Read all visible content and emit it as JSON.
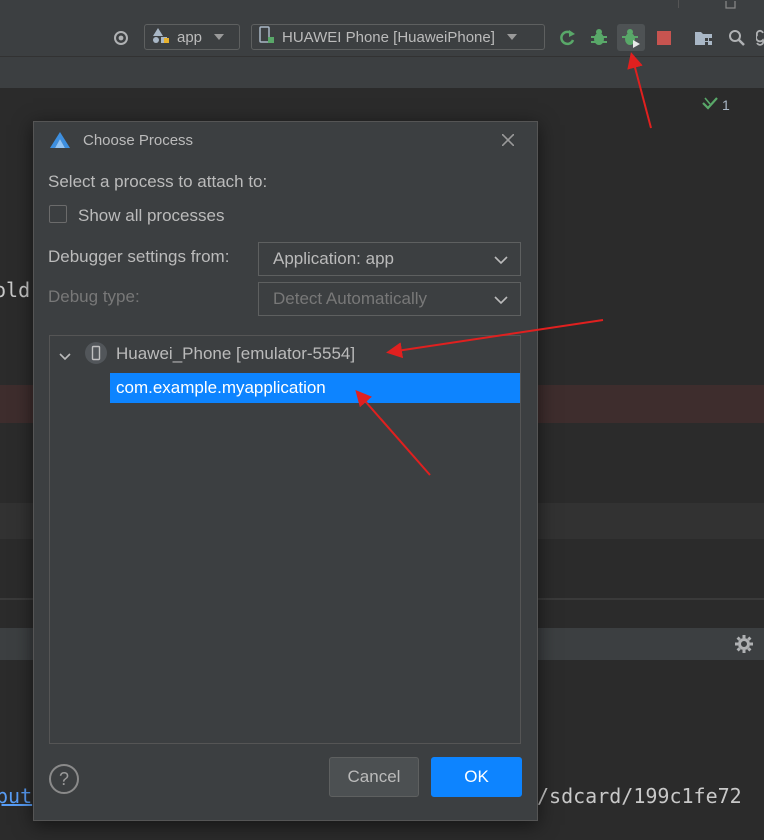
{
  "toolbar": {
    "config_combo": "app",
    "device_combo": "HUAWEI Phone [HuaweiPhone]"
  },
  "editor": {
    "inspection_count": "1",
    "code_fragment": "old",
    "console_link_fragment": "put",
    "console_path_fragment": "/sdcard/199c1fe72"
  },
  "dialog": {
    "title": "Choose Process",
    "select_label": "Select a process to attach to:",
    "show_all_label": "Show all processes",
    "show_all_checked": false,
    "debugger_settings_label": "Debugger settings from:",
    "debugger_settings_value": "Application: app",
    "debug_type_label": "Debug type:",
    "debug_type_value": "Detect Automatically",
    "tree": {
      "device": "Huawei_Phone [emulator-5554]",
      "process": "com.example.myapplication"
    },
    "help": "?",
    "cancel_label": "Cancel",
    "ok_label": "OK"
  },
  "colors": {
    "accent": "#0d84ff",
    "annotation_arrow": "#e0201f",
    "dialog_bg": "#3c3f41",
    "editor_bg": "#2b2b2b"
  }
}
